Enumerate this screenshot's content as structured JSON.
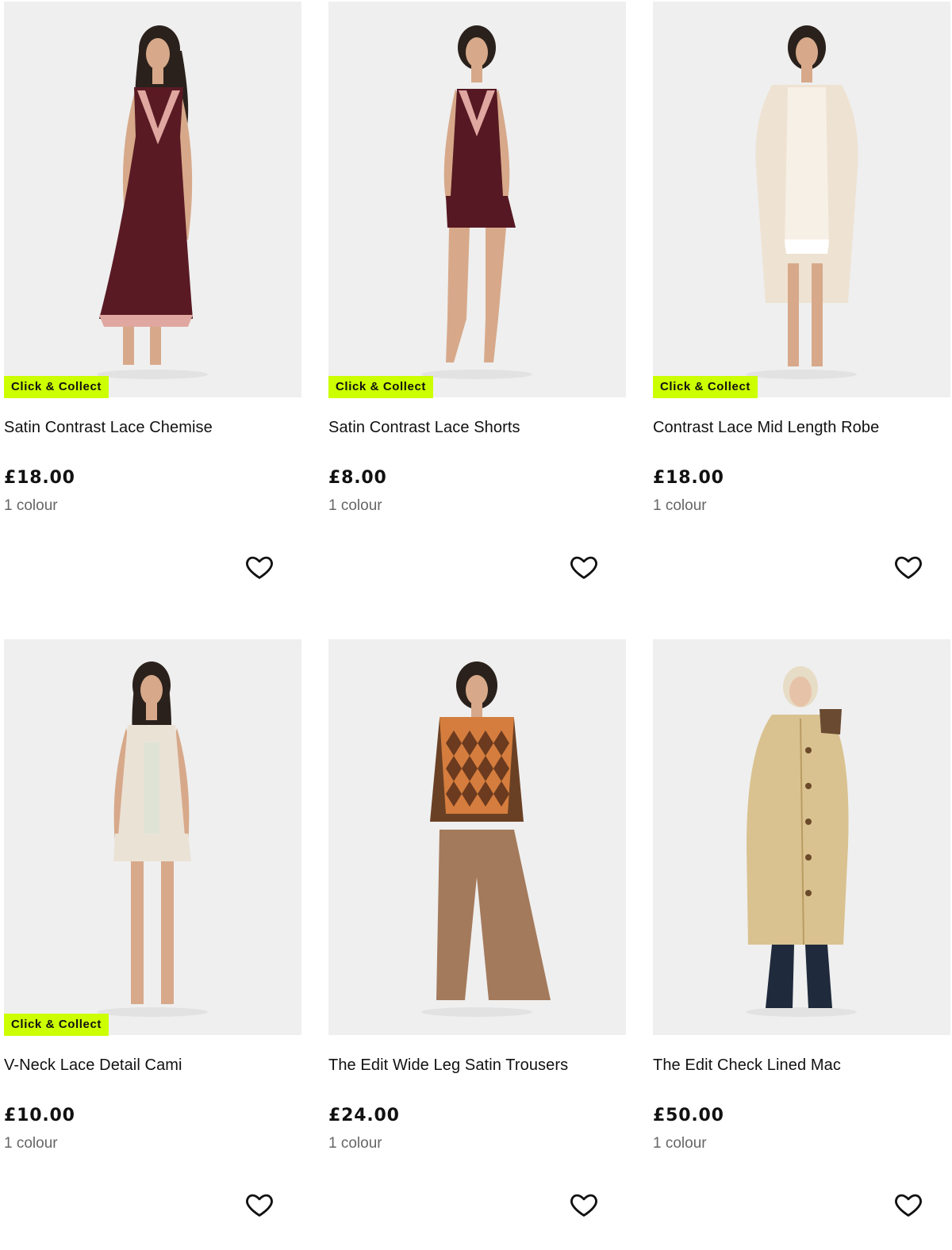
{
  "products": [
    {
      "name": "Satin Contrast Lace Chemise",
      "price": "£18.00",
      "colours": "1 colour",
      "badge": "Click & Collect",
      "image": "burgundy-satin-chemise-photo",
      "colors": {
        "garment": "#5a1a24",
        "lace": "#e0a7a0",
        "hair": "#2b211c",
        "skin": "#d7a98a"
      }
    },
    {
      "name": "Satin Contrast Lace Shorts",
      "price": "£8.00",
      "colours": "1 colour",
      "badge": "Click & Collect",
      "image": "burgundy-satin-cami-shorts-photo",
      "colors": {
        "garment": "#561822",
        "lace": "#e0a7a0",
        "hair": "#2b211c",
        "skin": "#d7a98a"
      }
    },
    {
      "name": "Contrast Lace Mid Length Robe",
      "price": "£18.00",
      "colours": "1 colour",
      "badge": "Click & Collect",
      "image": "cream-lace-robe-photo",
      "colors": {
        "garment": "#eee2d2",
        "lace": "#f7f0e6",
        "hair": "#2b211c",
        "skin": "#d7a98a"
      }
    },
    {
      "name": "V-Neck Lace Detail Cami",
      "price": "£10.00",
      "colours": "1 colour",
      "badge": "Click & Collect",
      "image": "cream-lace-cami-shorts-photo",
      "colors": {
        "garment": "#ebe2d6",
        "lace": "#dfe3d6",
        "hair": "#2b211c",
        "skin": "#d7a98a"
      }
    },
    {
      "name": "The Edit Wide Leg Satin Trousers",
      "price": "£24.00",
      "colours": "1 colour",
      "badge": "",
      "image": "argyle-vest-wide-trousers-photo",
      "colors": {
        "garment": "#a47a5c",
        "lace": "#d57d3e",
        "hair": "#2b211c",
        "skin": "#d7a98a",
        "top": "#6a4024"
      }
    },
    {
      "name": "The Edit Check Lined Mac",
      "price": "£50.00",
      "colours": "1 colour",
      "badge": "",
      "image": "beige-mac-coat-photo",
      "colors": {
        "garment": "#d9c290",
        "lace": "#b99c62",
        "hair": "#e7dcc6",
        "skin": "#e6c2a8",
        "top": "#1f2a3c"
      }
    }
  ],
  "wishlist_icon": "heart-outline-icon",
  "accent": "#ccff00"
}
